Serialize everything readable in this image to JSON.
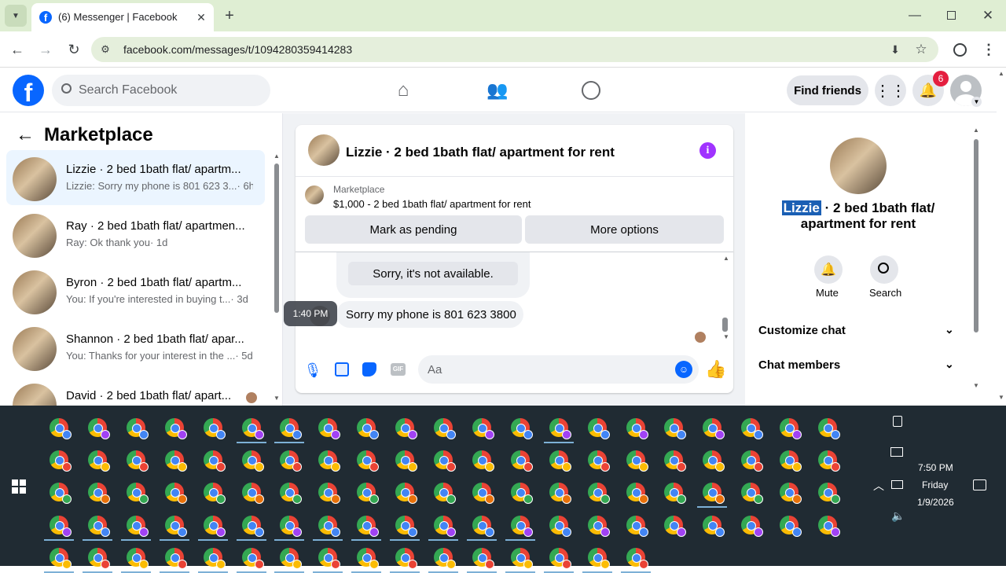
{
  "browser": {
    "tab_title": "(6) Messenger | Facebook",
    "url": "facebook.com/messages/t/1094280359414283"
  },
  "fb_header": {
    "search_placeholder": "Search Facebook",
    "find_friends": "Find friends",
    "notification_count": "6"
  },
  "left_panel": {
    "title": "Marketplace",
    "conversations": [
      {
        "name": "Lizzie · 2 bed 1bath flat/ apartm...",
        "preview": "Lizzie: Sorry my phone is 801 623 3...",
        "time": "· 6h"
      },
      {
        "name": "Ray · 2 bed 1bath flat/ apartmen...",
        "preview": "Ray: Ok thank you",
        "time": "· 1d"
      },
      {
        "name": "Byron · 2 bed 1bath flat/ apartm...",
        "preview": "You: If you're interested in buying t...",
        "time": "· 3d"
      },
      {
        "name": "Shannon · 2 bed 1bath flat/ apar...",
        "preview": "You: Thanks for your interest in the ...",
        "time": "· 5d"
      },
      {
        "name": "David · 2 bed 1bath flat/ apart...",
        "preview": "",
        "time": ""
      }
    ]
  },
  "chat": {
    "title": "Lizzie · 2 bed 1bath flat/ apartment for rent",
    "listing_label": "Marketplace",
    "listing_text": "$1,000 - 2 bed 1bath flat/ apartment for rent",
    "mark_pending": "Mark as pending",
    "more_options": "More options",
    "msg_bubble_1": "Sorry, it's not available.",
    "msg_time": "1:40 PM",
    "msg_bubble_2": "Sorry my phone is 801 623 3800",
    "composer_placeholder": "Aa"
  },
  "right_panel": {
    "name_highlight": "Lizzie",
    "name_line1_rest": " · 2 bed 1bath flat/",
    "name_line2": "apartment for rent",
    "mute": "Mute",
    "search": "Search",
    "customize_chat": "Customize chat",
    "chat_members": "Chat members"
  },
  "taskbar": {
    "time": "7:50 PM",
    "day": "Friday",
    "date": "1/9/2026"
  },
  "colors": {
    "fb_blue": "#0866ff",
    "messenger_purple": "#a033ff",
    "notification_red": "#e41e3f",
    "tab_strip": "#dfeed3",
    "taskbar": "#202b33"
  }
}
